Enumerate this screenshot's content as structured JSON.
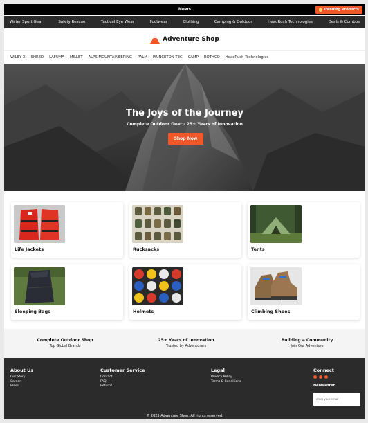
{
  "topbar": {
    "news": "News",
    "trending_label": "Trending Products"
  },
  "categories": [
    "Water Sport Gear",
    "Safety Rescue",
    "Tactical Eye Wear",
    "Footwear",
    "Clothing",
    "Camping & Outdoor",
    "HeadRush Technologies",
    "Deals & Combos"
  ],
  "logo": {
    "name": "Adventure Shop"
  },
  "brands": [
    "WILEY X",
    "SHRED",
    "LAFUMA",
    "MILLET",
    "ALPS MOUNTAINEERING",
    "PALM",
    "PRINCETON TEC",
    "CAMP",
    "ROTHCO",
    "HeadRush Technologies"
  ],
  "hero": {
    "title": "The Joys of the Journey",
    "subtitle": "Complete Outdoor Gear - 25+ Years of Innovation",
    "button": "Shop Now"
  },
  "products": [
    "Life Jackets",
    "Rucksacks",
    "Tents",
    "Sleeping Bags",
    "Helmets",
    "Climbing Shoes"
  ],
  "features": [
    {
      "title": "Complete Outdoor Shop",
      "subtitle": "Top Global Brands"
    },
    {
      "title": "25+ Years of Innovation",
      "subtitle": "Trusted by Adventurers"
    },
    {
      "title": "Building a Community",
      "subtitle": "Join Our Adventure"
    }
  ],
  "footer": {
    "about": {
      "title": "About Us",
      "links": [
        "Our Story",
        "Career",
        "Press"
      ]
    },
    "service": {
      "title": "Customer Service",
      "links": [
        "Contact",
        "FAQ",
        "Returns"
      ]
    },
    "legal": {
      "title": "Legal",
      "links": [
        "Privacy Policy",
        "Terms & Conditions"
      ]
    },
    "connect": {
      "title": "Connect",
      "newsletter": "Newsletter",
      "email_placeholder": "enter your email"
    },
    "copyright": "© 2023 Adventure Shop. All rights reserved."
  },
  "colors": {
    "accent": "#f0582a",
    "dark": "#2b2b2b"
  }
}
